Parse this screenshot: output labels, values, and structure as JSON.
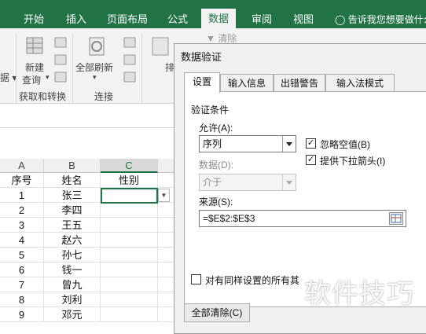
{
  "ribbon_tabs": [
    "开始",
    "插入",
    "页面布局",
    "公式",
    "数据",
    "审阅",
    "视图"
  ],
  "tell_me": "告诉我您想要做什么",
  "ribbon": {
    "new_query": "新建",
    "new_query_2": "查询",
    "refresh_all": "全部刷新",
    "group_get_transform": "获取和转换",
    "group_connections": "连接",
    "clear": "清除"
  },
  "grid": {
    "columns": [
      "A",
      "B",
      "C"
    ],
    "headers": [
      "序号",
      "姓名",
      "性别"
    ],
    "rows": [
      {
        "num": "1",
        "name": "张三"
      },
      {
        "num": "2",
        "name": "李四"
      },
      {
        "num": "3",
        "name": "王五"
      },
      {
        "num": "4",
        "name": "赵六"
      },
      {
        "num": "5",
        "name": "孙七"
      },
      {
        "num": "6",
        "name": "钱一"
      },
      {
        "num": "7",
        "name": "曾九"
      },
      {
        "num": "8",
        "name": "刘利"
      },
      {
        "num": "9",
        "name": "邓元"
      }
    ]
  },
  "dialog": {
    "title": "数据验证",
    "tabs": [
      "设置",
      "输入信息",
      "出错警告",
      "输入法模式"
    ],
    "section": "验证条件",
    "allow_label": "允许(A):",
    "allow_value": "序列",
    "data_label": "数据(D):",
    "data_value": "介于",
    "ignore_blank": "忽略空值(B)",
    "dropdown_arrow": "提供下拉箭头(I)",
    "source_label": "来源(S):",
    "source_value": "=$E$2:$E$3",
    "apply_all": "对有同样设置的所有其",
    "clear_all": "全部清除(C)"
  },
  "watermark": "软件技巧"
}
